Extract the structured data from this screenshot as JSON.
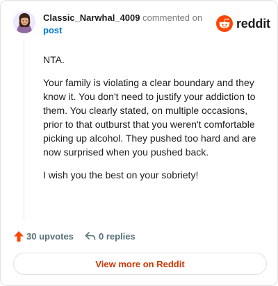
{
  "header": {
    "username": "Classic_Narwhal_4009",
    "action_text": "commented on",
    "post_link": "post",
    "logo_text": "reddit"
  },
  "comment": {
    "paragraphs": [
      "NTA.",
      "Your family is violating a clear boundary and they know it. You don't need to justify your addiction to them. You clearly stated, on multiple occasions, prior to that outburst that you weren't comfortable picking up alcohol. They pushed too hard and are now surprised when you pushed back.",
      "I wish you the best on your sobriety!"
    ]
  },
  "footer": {
    "upvotes": "30 upvotes",
    "replies": "0 replies",
    "view_more": "View more on Reddit"
  },
  "icons": {
    "upvote": "arrow-up-icon",
    "reply": "reply-arrow-icon",
    "logo": "reddit-snoo-icon",
    "avatar": "user-avatar"
  },
  "colors": {
    "accent": "#ff4500",
    "link": "#0079d3",
    "view_more_text": "#cc3700",
    "muted": "#576f76"
  }
}
